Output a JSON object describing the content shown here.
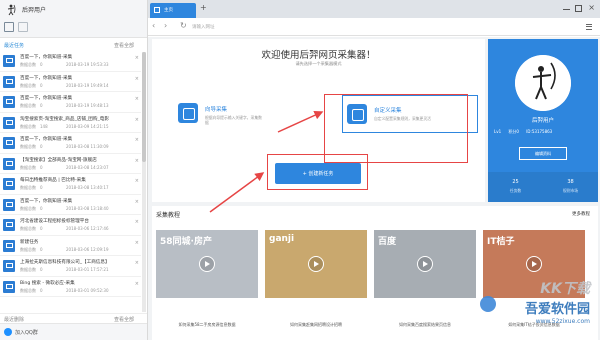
{
  "sidebar": {
    "username": "后羿用户",
    "header_title": "最近任务",
    "header_all": "查看全部",
    "footer_left": "最近删除",
    "footer_right": "查看全部",
    "qq_label": "加入QQ群",
    "scroll_position": 0.0,
    "count_label": "数据总数",
    "tasks": [
      {
        "title": "百度一下，你就知道-采集",
        "count": "0",
        "date": "2018-03-19 19:53:33"
      },
      {
        "title": "百度一下，你就知道-采集",
        "count": "0",
        "date": "2018-03-19 19:49:14"
      },
      {
        "title": "百度一下，你就知道-采集",
        "count": "0",
        "date": "2018-03-19 19:48:13"
      },
      {
        "title": "淘宝搜索页-淘宝搜索_商品_店铺_团购_电影",
        "count": "148",
        "date": "2018-03-09 14:21:15"
      },
      {
        "title": "百度一下，你就知道-采集",
        "count": "0",
        "date": "2018-03-08 11:30:09"
      },
      {
        "title": "【淘宝搜索】全部商品-淘宝网-旗舰店",
        "count": "0",
        "date": "2018-03-08 14:23:07"
      },
      {
        "title": "每日出特推荐商品 | 巴比特-采集",
        "count": "0",
        "date": "2018-03-08 13:40:17"
      },
      {
        "title": "百度一下，你就知道-采集",
        "count": "0",
        "date": "2018-03-08 13:18:40"
      },
      {
        "title": "河北省建设工程招标投标管理平台",
        "count": "0",
        "date": "2018-03-06 12:17:46"
      },
      {
        "title": "新建任务",
        "count": "0",
        "date": "2018-03-06 12:09:19"
      },
      {
        "title": "上海拉夫斯信息科技有限公司_【工商信息】",
        "count": "0",
        "date": "2018-03-01 17:57:21"
      },
      {
        "title": "Bing 搜索 - 微软必应-采集",
        "count": "0",
        "date": "2018-03-01 09:52:30"
      }
    ]
  },
  "browser": {
    "tab_label": "主页",
    "tab_add": "+",
    "url_placeholder": "请输入网址",
    "nav": {
      "back": "‹",
      "forward": "›",
      "reload": "↻"
    },
    "window": {
      "close": "×"
    }
  },
  "welcome": {
    "title": "欢迎使用后羿网页采集器！",
    "subtitle": "请先选择一个采集器模式",
    "modes": [
      {
        "title": "向导采集",
        "desc": "根据向导提示输入关键字，采集数据"
      },
      {
        "title": "自定义采集",
        "desc": "自定义配置采集规则，采集更灵活"
      }
    ],
    "create_button": "+ 创建新任务"
  },
  "profile": {
    "name": "后羿用户",
    "stats": [
      "Lv1",
      "积分0",
      "ID:53175863"
    ],
    "edit_button": "编辑资料",
    "tasks_num": "25",
    "tasks_label": "任务数",
    "market_num": "38",
    "market_label": "规则市场"
  },
  "tutorials": {
    "title": "采集教程",
    "more": "更多教程",
    "items": [
      {
        "logo": "58同城·房产",
        "caption": "如何采集58二手房房源信息数据",
        "color": "#b8bec5"
      },
      {
        "logo": "ganji",
        "caption": "如何采集赶集网招聘设计招聘",
        "color": "#c9a86e"
      },
      {
        "logo": "百度",
        "caption": "如何采集百度搜索结果页信息",
        "color": "#a7adb3"
      },
      {
        "logo": "IT桔子",
        "caption": "如何采集IT桔子投资信息数据",
        "color": "#c57a5a"
      }
    ]
  },
  "watermark": {
    "line1": "KK下载",
    "line2": "吾爱软件园",
    "line3": "www.52zixue.com"
  },
  "colors": {
    "accent": "#2e86de",
    "highlight": "#e64545"
  }
}
